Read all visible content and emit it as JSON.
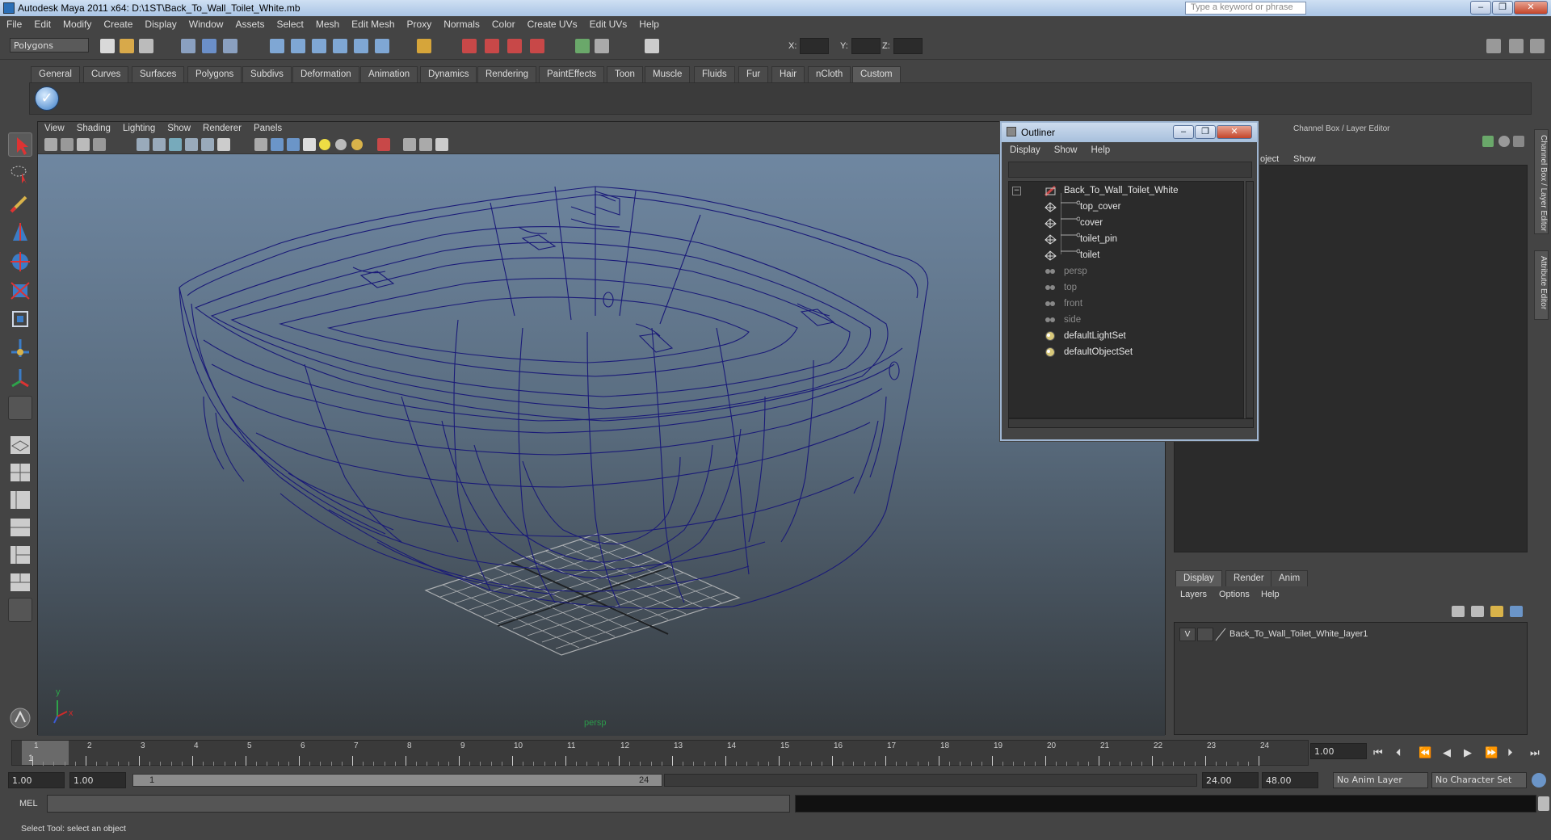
{
  "window": {
    "title": "Autodesk Maya 2011 x64: D:\\1ST\\Back_To_Wall_Toilet_White.mb",
    "search_placeholder": "Type a keyword or phrase",
    "minimize": "–",
    "restore": "❐",
    "close": "✕"
  },
  "menubar": [
    "File",
    "Edit",
    "Modify",
    "Create",
    "Display",
    "Window",
    "Assets",
    "Select",
    "Mesh",
    "Edit Mesh",
    "Proxy",
    "Normals",
    "Color",
    "Create UVs",
    "Edit UVs",
    "Help"
  ],
  "status": {
    "mode": "Polygons",
    "x_label": "X:",
    "y_label": "Y:",
    "z_label": "Z:"
  },
  "shelf_tabs": [
    "General",
    "Curves",
    "Surfaces",
    "Polygons",
    "Subdivs",
    "Deformation",
    "Animation",
    "Dynamics",
    "Rendering",
    "PaintEffects",
    "Toon",
    "Muscle",
    "Fluids",
    "Fur",
    "Hair",
    "nCloth",
    "Custom"
  ],
  "shelf_active": "Custom",
  "viewport": {
    "menu": [
      "View",
      "Shading",
      "Lighting",
      "Show",
      "Renderer",
      "Panels"
    ],
    "camera_label": "persp",
    "axis_y": "y",
    "axis_x": "x"
  },
  "outliner": {
    "title": "Outliner",
    "menu": [
      "Display",
      "Show",
      "Help"
    ],
    "collapse_symbol": "−",
    "items": [
      {
        "label": "Back_To_Wall_Toilet_White",
        "type": "group",
        "dim": false
      },
      {
        "label": "top_cover",
        "type": "mesh",
        "dim": false
      },
      {
        "label": "cover",
        "type": "mesh",
        "dim": false
      },
      {
        "label": "toilet_pin",
        "type": "mesh",
        "dim": false
      },
      {
        "label": "toilet",
        "type": "mesh",
        "dim": false
      },
      {
        "label": "persp",
        "type": "camera",
        "dim": true
      },
      {
        "label": "top",
        "type": "camera",
        "dim": true
      },
      {
        "label": "front",
        "type": "camera",
        "dim": true
      },
      {
        "label": "side",
        "type": "camera",
        "dim": true
      },
      {
        "label": "defaultLightSet",
        "type": "set",
        "dim": false
      },
      {
        "label": "defaultObjectSet",
        "type": "set",
        "dim": false
      }
    ]
  },
  "channel_box": {
    "title": "Channel Box / Layer Editor",
    "menu_partial": "oject",
    "menu_show": "Show",
    "layer_tabs": [
      "Display",
      "Render",
      "Anim"
    ],
    "layer_active": "Display",
    "layer_menu": [
      "Layers",
      "Options",
      "Help"
    ],
    "layer": {
      "visible": "V",
      "name": "Back_To_Wall_Toilet_White_layer1"
    }
  },
  "side_tabs": [
    "Channel Box / Layer Editor",
    "Attribute Editor"
  ],
  "timeline": {
    "ticks": [
      "1",
      "2",
      "3",
      "4",
      "5",
      "6",
      "7",
      "8",
      "9",
      "10",
      "11",
      "12",
      "13",
      "14",
      "15",
      "16",
      "17",
      "18",
      "19",
      "20",
      "21",
      "22",
      "23",
      "24"
    ],
    "current_frame_marker": "1",
    "current_time": "1.00"
  },
  "range": {
    "start_time": "1.00",
    "playback_start": "1.00",
    "range_start_label": "1",
    "range_end_label": "24",
    "playback_end": "24.00",
    "end_time": "48.00",
    "anim_layer": "No Anim Layer",
    "character_set": "No Character Set"
  },
  "command": {
    "label": "MEL"
  },
  "help_line": "Select Tool: select an object",
  "colors": {
    "wire": "#1a1a78",
    "grid": "#c8c8c8",
    "axis_y": "#2ea34a",
    "axis_x": "#d12a2a",
    "title_gradient_top": "#cfe0f3"
  }
}
